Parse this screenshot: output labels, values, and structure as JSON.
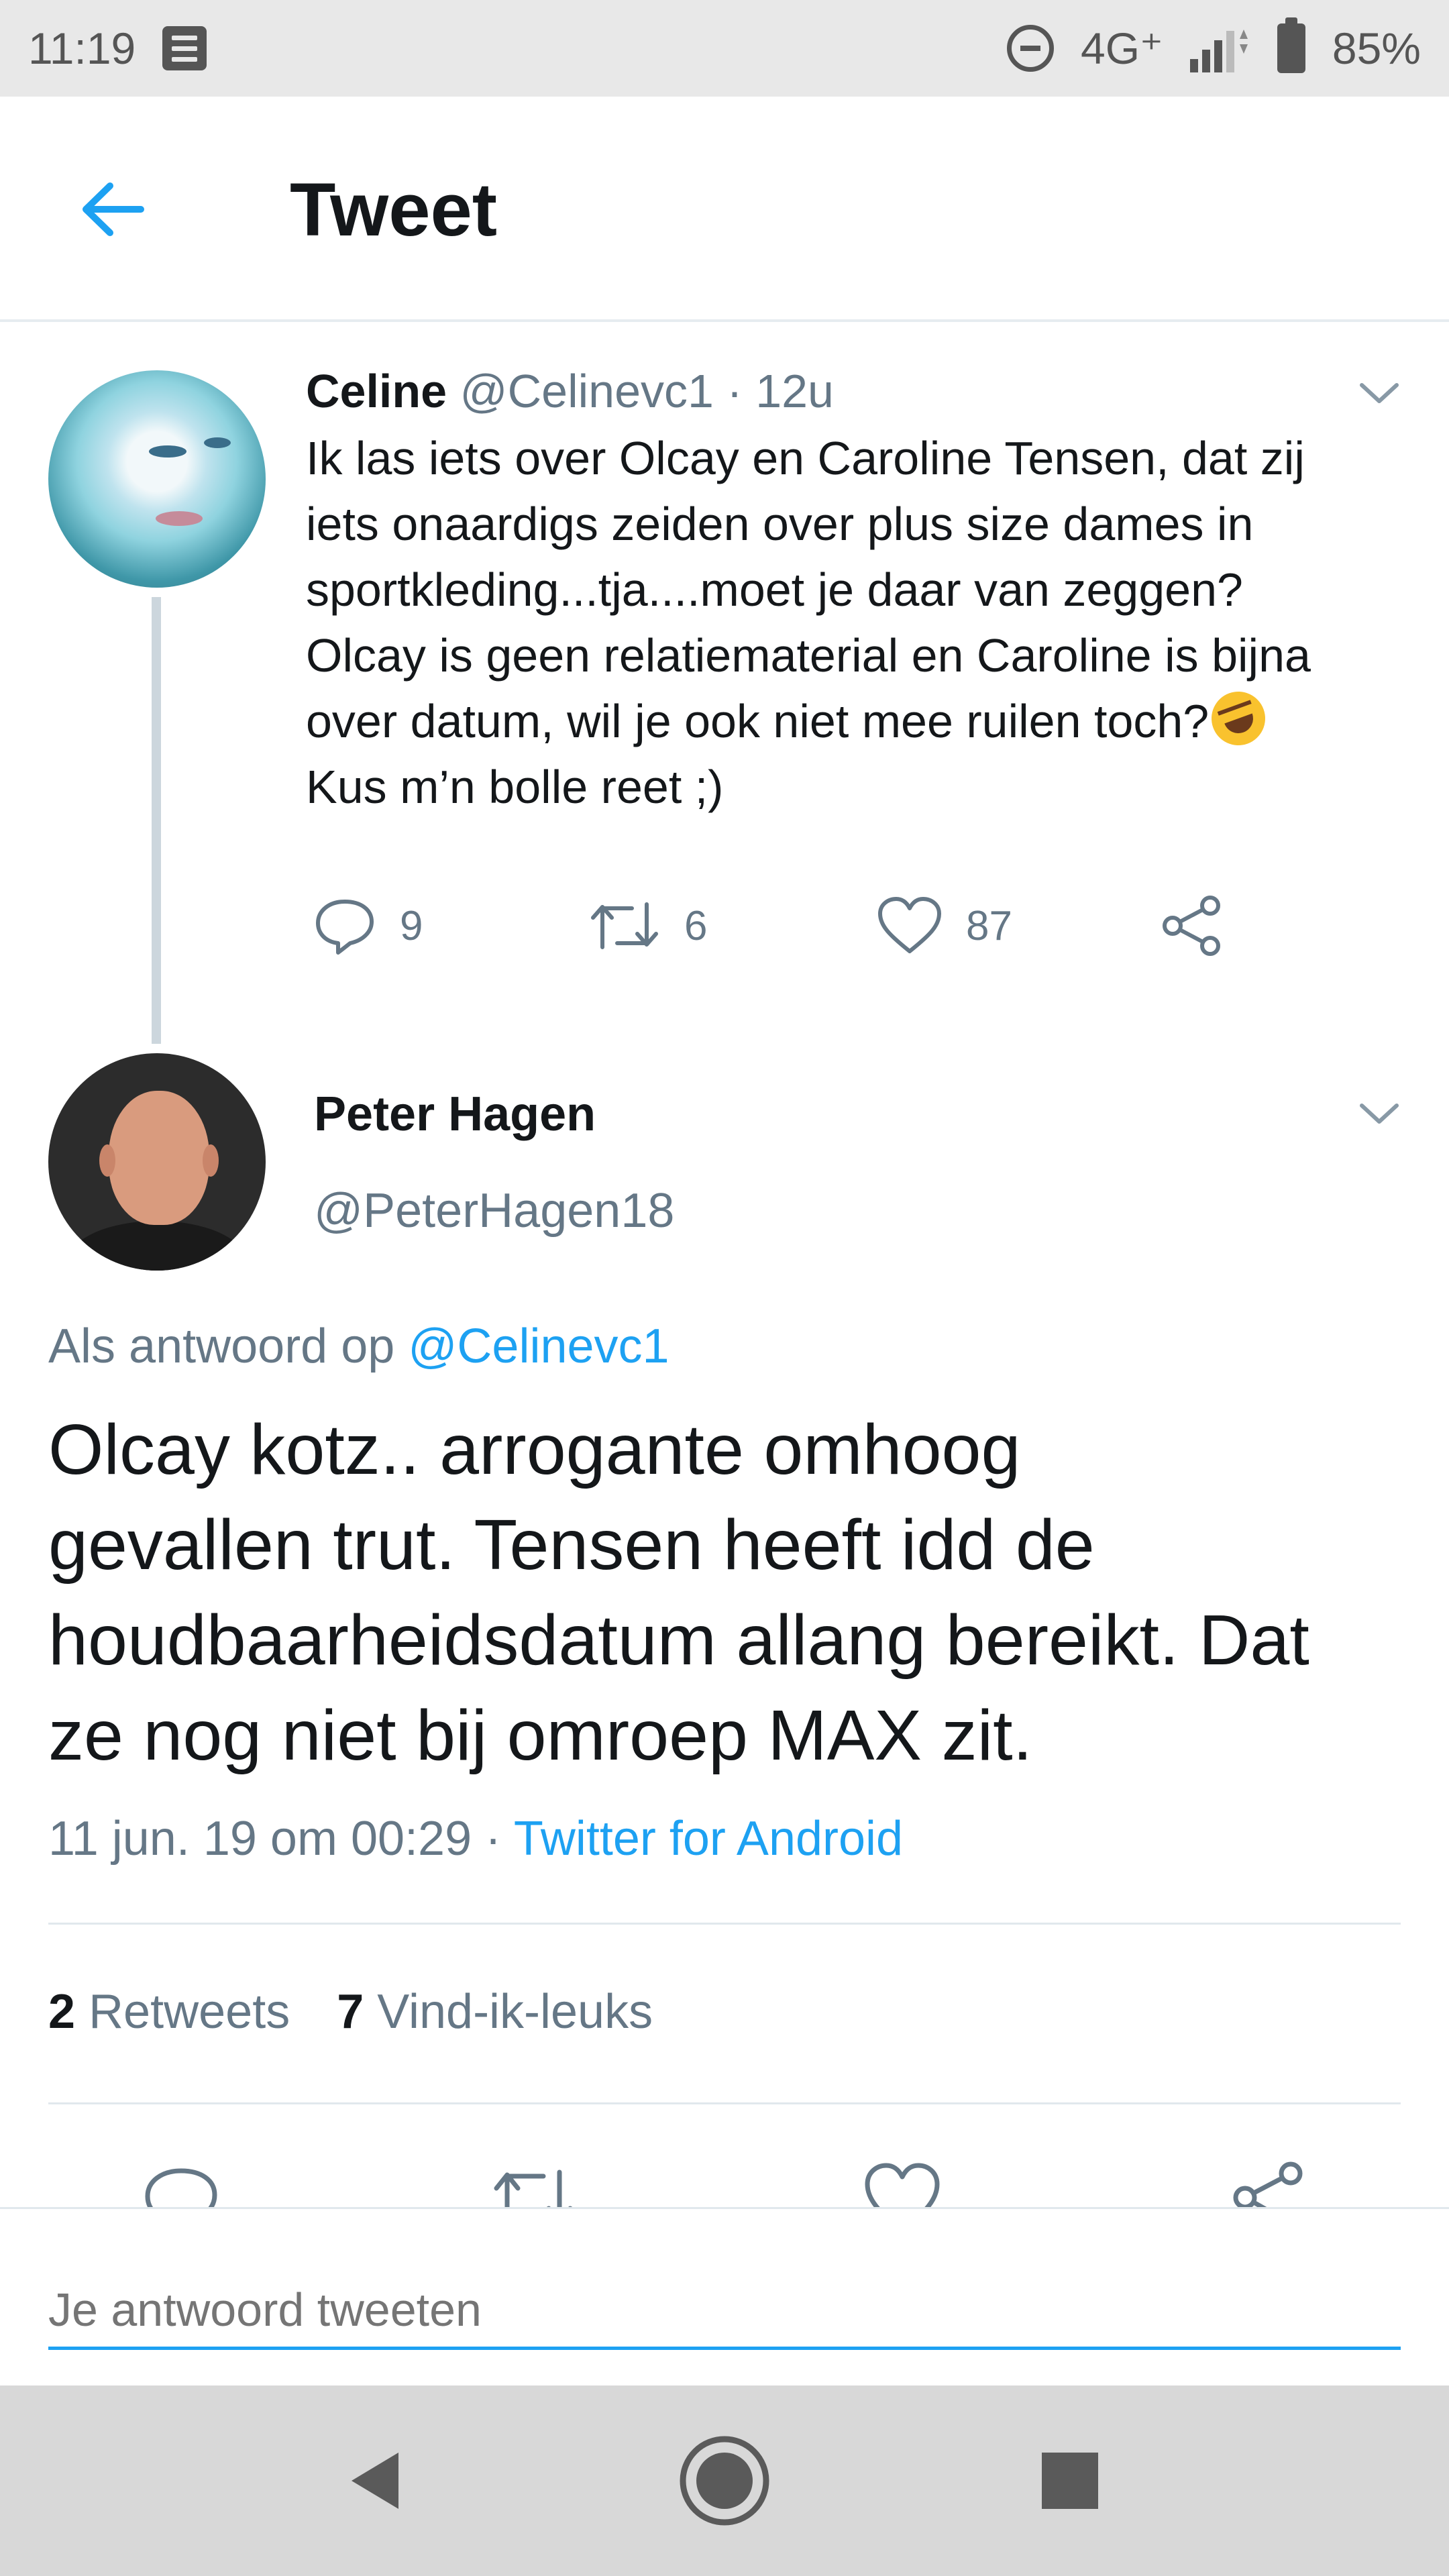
{
  "status_bar": {
    "time": "11:19",
    "network": "4G⁺",
    "battery": "85%"
  },
  "app_bar": {
    "title": "Tweet"
  },
  "parent_tweet": {
    "name": "Celine",
    "handle": "@Celinevc1",
    "separator": "·",
    "age": "12u",
    "text_lines": [
      "Ik las iets over Olcay en Caroline Tensen, dat zij",
      "iets onaardigs zeiden over plus size dames in",
      "sportkleding...tja....moet je daar van zeggen?",
      "Olcay is geen relatiematerial en Caroline is bijna",
      "over datum, wil je ook niet mee ruilen toch?",
      "Kus m’n bolle reet ;)"
    ],
    "emoji": "rolling-on-floor-laughing",
    "replies": "9",
    "retweets": "6",
    "likes": "87"
  },
  "main_tweet": {
    "name": "Peter Hagen",
    "handle": "@PeterHagen18",
    "reply_prefix": "Als antwoord op",
    "reply_mention": "@Celinevc1",
    "text_lines": [
      "Olcay kotz.. arrogante omhoog",
      "gevallen trut. Tensen heeft idd de",
      "houdbaarheidsdatum allang bereikt. Dat",
      "ze nog niet bij omroep MAX zit."
    ],
    "timestamp": "11 jun. 19 om 00:29",
    "separator": "·",
    "source": "Twitter for Android",
    "retweet_count": "2",
    "retweet_label": "Retweets",
    "like_count": "7",
    "like_label": "Vind-ik-leuks"
  },
  "composer": {
    "placeholder": "Je antwoord tweeten"
  },
  "icons": {
    "back": "arrow-left-icon",
    "caret": "chevron-down-icon",
    "reply": "reply-icon",
    "retweet": "retweet-icon",
    "like": "heart-icon",
    "share": "share-icon"
  },
  "colors": {
    "accent": "#1da1f2",
    "secondary_text": "#657786",
    "primary_text": "#14171a"
  }
}
